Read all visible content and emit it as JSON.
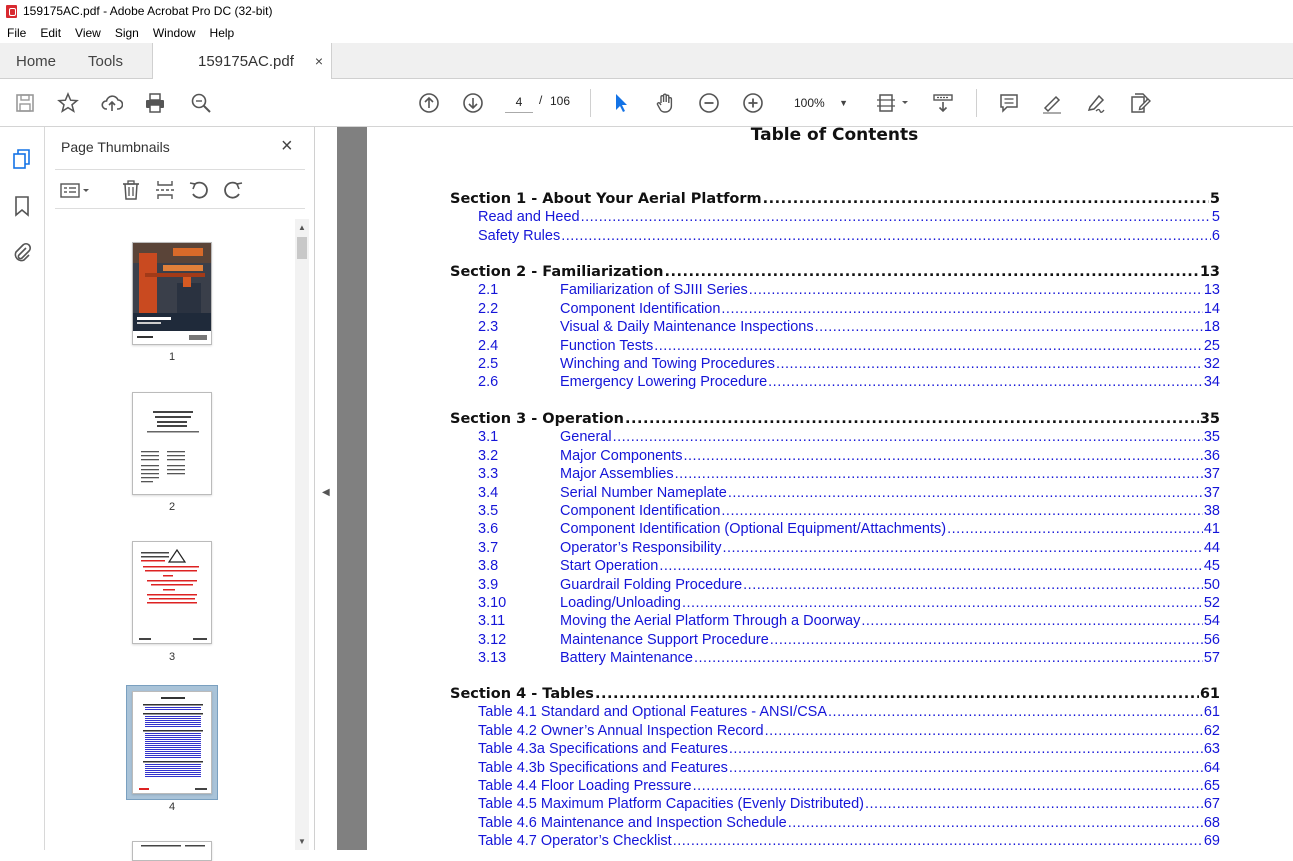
{
  "window": {
    "title": "159175AC.pdf - Adobe Acrobat Pro DC (32-bit)"
  },
  "menu": [
    "File",
    "Edit",
    "View",
    "Sign",
    "Window",
    "Help"
  ],
  "tabs": {
    "home": "Home",
    "tools": "Tools",
    "document": "159175AC.pdf",
    "close_glyph": "×"
  },
  "toolbar": {
    "page_current": "4",
    "page_separator": "/",
    "page_total": "106",
    "zoom": "100%"
  },
  "sidebar": {
    "title": "Page Thumbnails",
    "close_glyph": "×",
    "thumbnails": [
      "1",
      "2",
      "3",
      "4"
    ],
    "selected_page": "4"
  },
  "document": {
    "title": "Table of Contents",
    "sections": [
      {
        "label": "Section 1 - About Your Aerial Platform",
        "page": "5",
        "items": [
          {
            "num": "",
            "label": "Read and Heed",
            "page": "5"
          },
          {
            "num": "",
            "label": "Safety Rules",
            "page": "6"
          }
        ]
      },
      {
        "label": "Section 2 - Familiarization",
        "page": "13",
        "items": [
          {
            "num": "2.1",
            "label": "Familiarization of SJIII Series",
            "page": "13"
          },
          {
            "num": "2.2",
            "label": "Component Identification",
            "page": "14"
          },
          {
            "num": "2.3",
            "label": "Visual & Daily Maintenance Inspections",
            "page": "18"
          },
          {
            "num": "2.4",
            "label": "Function Tests",
            "page": "25"
          },
          {
            "num": "2.5",
            "label": "Winching and Towing Procedures",
            "page": "32"
          },
          {
            "num": "2.6",
            "label": "Emergency Lowering Procedure",
            "page": "34"
          }
        ]
      },
      {
        "label": "Section 3 - Operation",
        "page": "35",
        "items": [
          {
            "num": "3.1",
            "label": "General",
            "page": "35"
          },
          {
            "num": "3.2",
            "label": "Major Components",
            "page": "36"
          },
          {
            "num": "3.3",
            "label": "Major Assemblies",
            "page": "37"
          },
          {
            "num": "3.4",
            "label": "Serial Number Nameplate",
            "page": "37"
          },
          {
            "num": "3.5",
            "label": "Component Identification",
            "page": "38"
          },
          {
            "num": "3.6",
            "label": "Component Identification (Optional Equipment/Attachments)",
            "page": "41"
          },
          {
            "num": "3.7",
            "label": "Operator’s Responsibility",
            "page": "44"
          },
          {
            "num": "3.8",
            "label": "Start Operation",
            "page": "45"
          },
          {
            "num": "3.9",
            "label": "Guardrail Folding Procedure",
            "page": "50"
          },
          {
            "num": "3.10",
            "label": "Loading/Unloading",
            "page": "52"
          },
          {
            "num": "3.11",
            "label": "Moving the Aerial Platform Through a Doorway",
            "page": "54"
          },
          {
            "num": "3.12",
            "label": "Maintenance Support Procedure",
            "page": "56"
          },
          {
            "num": "3.13",
            "label": "Battery Maintenance",
            "page": "57"
          }
        ]
      },
      {
        "label": "Section 4 - Tables",
        "page": "61",
        "items": [
          {
            "num": "",
            "label": "Table 4.1 Standard and Optional Features - ANSI/CSA",
            "page": "61"
          },
          {
            "num": "",
            "label": "Table 4.2 Owner’s Annual Inspection Record",
            "page": "62"
          },
          {
            "num": "",
            "label": "Table 4.3a Specifications and Features",
            "page": "63"
          },
          {
            "num": "",
            "label": "Table 4.3b Specifications and Features",
            "page": "64"
          },
          {
            "num": "",
            "label": "Table 4.4 Floor Loading Pressure",
            "page": "65"
          },
          {
            "num": "",
            "label": "Table 4.5 Maximum Platform Capacities (Evenly Distributed)",
            "page": "67"
          },
          {
            "num": "",
            "label": "Table 4.6 Maintenance and Inspection Schedule",
            "page": "68"
          },
          {
            "num": "",
            "label": "Table 4.7 Operator’s Checklist",
            "page": "69"
          }
        ]
      }
    ]
  },
  "colors": {
    "link": "#1515d8",
    "heading": "#111111",
    "acrobat_red": "#d8292f",
    "page_bg": "#808080"
  }
}
